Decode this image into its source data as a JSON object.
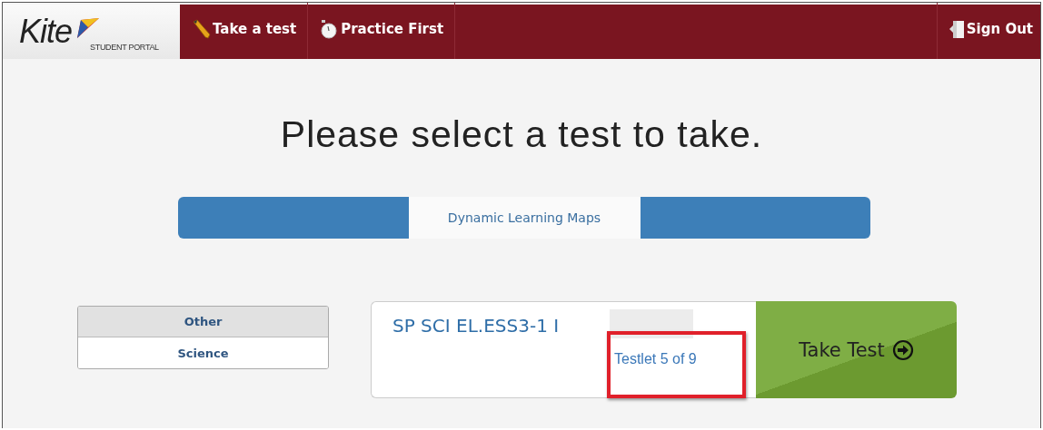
{
  "header": {
    "logo": {
      "name": "Kite",
      "subtitle": "STUDENT PORTAL"
    },
    "nav": [
      {
        "label": "Take a test"
      },
      {
        "label": "Practice First"
      }
    ],
    "sign_out": {
      "label": "Sign Out"
    }
  },
  "heading": "Please select a test to take.",
  "tabs": [
    {
      "label": "Dynamic Learning Maps",
      "selected": true
    }
  ],
  "subjects": [
    {
      "label": "Other",
      "selected": false
    },
    {
      "label": "Science",
      "selected": true
    }
  ],
  "test": {
    "title": "SP SCI EL.ESS3-1 I",
    "testlet": "Testlet 5 of 9",
    "highlighted": true,
    "button": "Take Test"
  }
}
